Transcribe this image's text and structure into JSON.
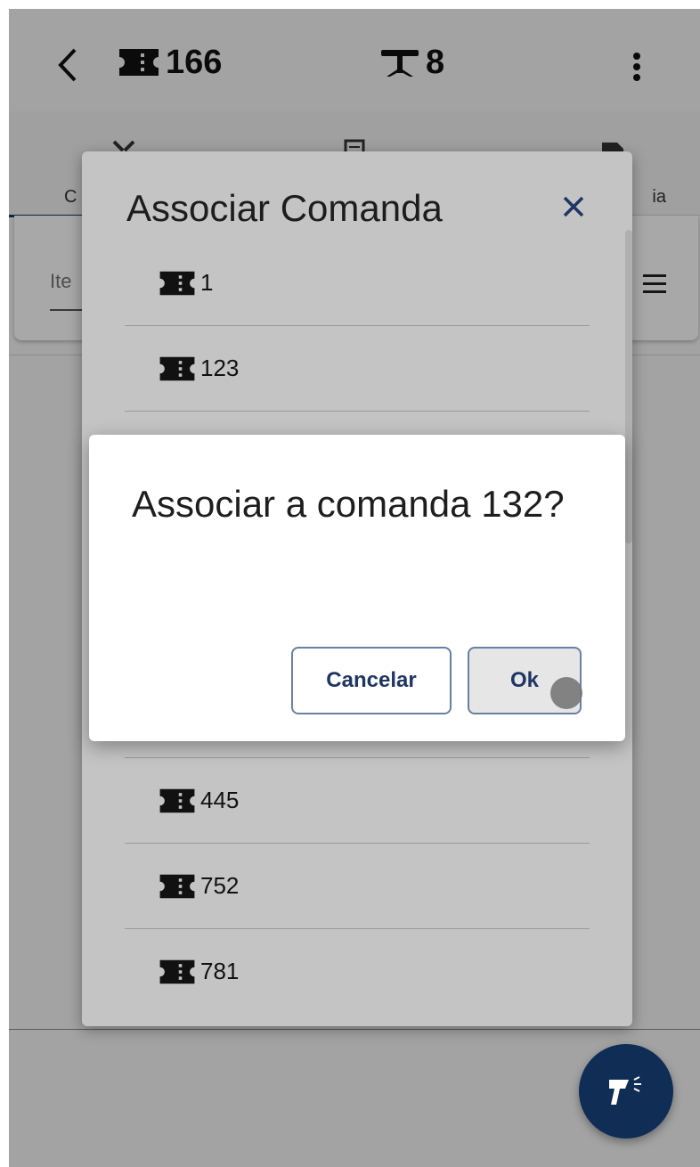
{
  "header": {
    "comanda_number": "166",
    "mesa_number": "8"
  },
  "tabs": [
    {
      "label": "C"
    },
    {
      "label": ""
    },
    {
      "label": "ia"
    }
  ],
  "filter": {
    "search_placeholder": "Ite"
  },
  "associar_dialog": {
    "title": "Associar Comanda",
    "items_top": [
      "1",
      "123"
    ],
    "items_bottom": [
      "445",
      "752",
      "781"
    ]
  },
  "confirm_dialog": {
    "message": "Associar a comanda 132?",
    "cancel_label": "Cancelar",
    "ok_label": "Ok"
  },
  "colors": {
    "primary": "#0f2d55",
    "button_text": "#1f3563",
    "button_border": "#6a7fa3"
  }
}
